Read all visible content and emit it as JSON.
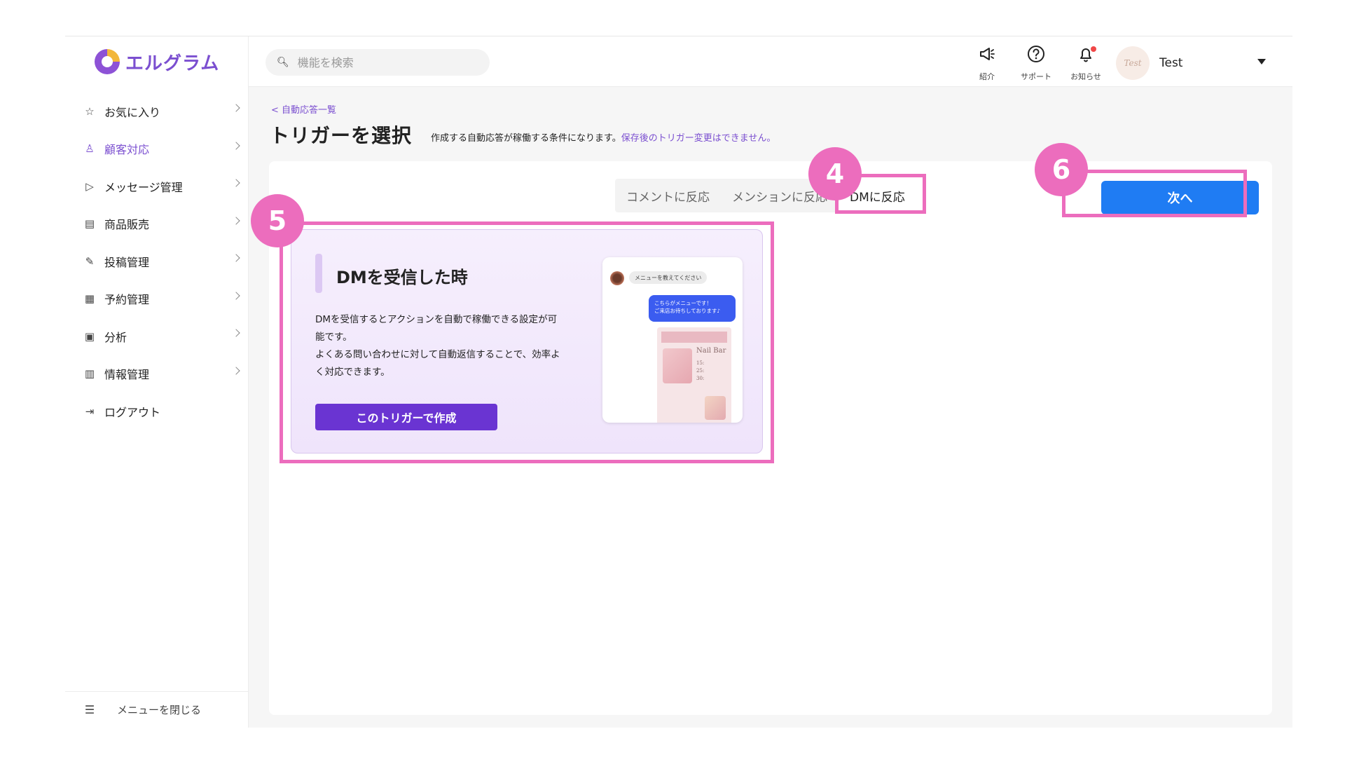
{
  "app": {
    "logo_text": "エルグラム"
  },
  "sidebar": {
    "items": [
      {
        "icon": "star-icon",
        "glyph": "☆",
        "label": "お気に入り"
      },
      {
        "icon": "person-icon",
        "glyph": "♙",
        "label": "顧客対応"
      },
      {
        "icon": "send-icon",
        "glyph": "▷",
        "label": "メッセージ管理"
      },
      {
        "icon": "store-icon",
        "glyph": "▤",
        "label": "商品販売"
      },
      {
        "icon": "edit-icon",
        "glyph": "✎",
        "label": "投稿管理"
      },
      {
        "icon": "calendar-icon",
        "glyph": "▦",
        "label": "予約管理"
      },
      {
        "icon": "report-icon",
        "glyph": "▣",
        "label": "分析"
      },
      {
        "icon": "bar-chart-icon",
        "glyph": "▥",
        "label": "情報管理"
      },
      {
        "icon": "logout-icon",
        "glyph": "⇥",
        "label": "ログアウト"
      }
    ],
    "close_menu_label": "メニューを閉じる"
  },
  "topbar": {
    "search_placeholder": "機能を検索",
    "buttons": [
      {
        "icon": "megaphone-icon",
        "label": "紹介"
      },
      {
        "icon": "help-icon",
        "label": "サポート"
      },
      {
        "icon": "bell-icon",
        "label": "お知らせ"
      }
    ],
    "user": {
      "avatar_text": "Test",
      "name": "Test"
    }
  },
  "main": {
    "breadcrumb": "自動応答一覧",
    "title": "トリガーを選択",
    "description": "作成する自動応答が稼働する条件になります。",
    "description_warning": "保存後のトリガー変更はできません。",
    "tabs": [
      {
        "label": "コメントに反応"
      },
      {
        "label": "メンションに反応"
      },
      {
        "label": "DMに反応"
      }
    ],
    "next_button": "次へ",
    "card": {
      "title": "DMを受信した時",
      "description_lines": [
        "DMを受信するとアクションを自動で稼働できる設定が可",
        "能です。",
        "よくある問い合わせに対して自動返信することで、効率よ",
        "く対応できます。"
      ],
      "create_button": "このトリガーで作成",
      "preview": {
        "incoming_message": "メニューを教えてください",
        "reply_line1": "こちらがメニューです！",
        "reply_line2": "ご来店お待ちしております♪",
        "menu_title": "Nail Bar",
        "menu_prices": [
          "15:",
          "25:",
          "30:"
        ]
      }
    }
  },
  "annotations": [
    {
      "number": "4"
    },
    {
      "number": "5"
    },
    {
      "number": "6"
    }
  ],
  "colors": {
    "accent": "#7b4fd0",
    "primary_button": "#1f7cf3",
    "create_button": "#6a34d2",
    "highlight": "#ec6dbd"
  }
}
